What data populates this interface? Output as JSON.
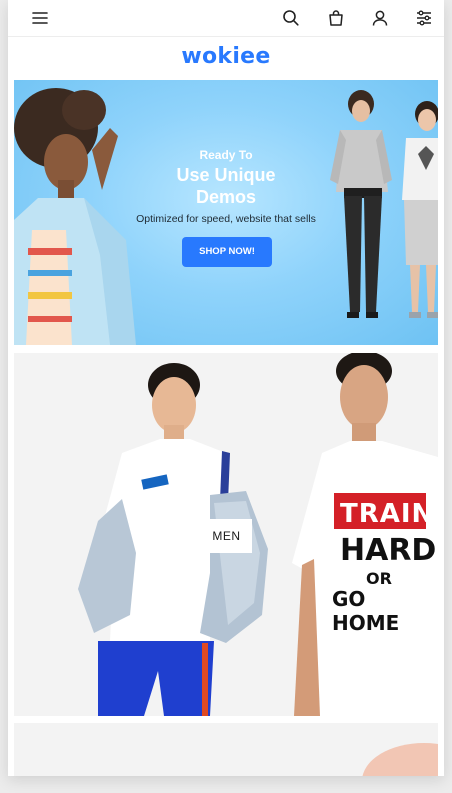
{
  "header": {
    "logo": "wokiee",
    "icons": [
      "menu-icon",
      "search-icon",
      "bag-icon",
      "account-icon",
      "settings-icon"
    ]
  },
  "hero": {
    "kicker": "Ready To",
    "title_line1": "Use Unique",
    "title_line2": "Demos",
    "subtitle": "Optimized for speed, website that sells",
    "button_label": "SHOP NOW!"
  },
  "men_block": {
    "label": "MEN",
    "shirt_left_text": "",
    "shirt_right": {
      "line1": "TRAIN",
      "line2": "HARD",
      "line3": "OR",
      "line4": "GO HOME"
    }
  },
  "colors": {
    "brand": "#2879fe",
    "hero_bg": "#8fd3fb",
    "block_bg": "#f3f3f3"
  }
}
